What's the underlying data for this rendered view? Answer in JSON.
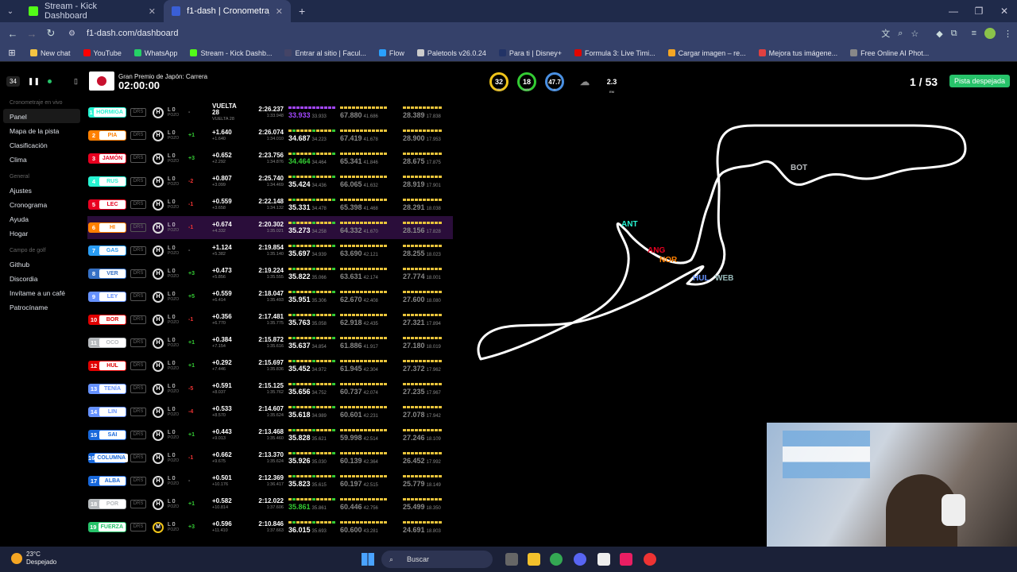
{
  "browser": {
    "tabs": [
      {
        "label": "Stream - Kick Dashboard",
        "color": "#53fc18"
      },
      {
        "label": "f1-dash | Cronometraje en vivo",
        "color": "#3a5fd6"
      }
    ],
    "url": "f1-dash.com/dashboard",
    "bookmarks": [
      {
        "label": "New chat",
        "color": "#f5c542"
      },
      {
        "label": "YouTube",
        "color": "#ff0000"
      },
      {
        "label": "WhatsApp",
        "color": "#25d366"
      },
      {
        "label": "Stream - Kick Dashb...",
        "color": "#53fc18"
      },
      {
        "label": "Entrar al sitio | Facul...",
        "color": "#444466"
      },
      {
        "label": "Flow",
        "color": "#2aa1ff"
      },
      {
        "label": "Paletools v26.0.24",
        "color": "#cccccc"
      },
      {
        "label": "Para ti | Disney+",
        "color": "#223366"
      },
      {
        "label": "Formula 3: Live Timi...",
        "color": "#e10600"
      },
      {
        "label": "Cargar imagen – re...",
        "color": "#f5a623"
      },
      {
        "label": "Mejora tus imágene...",
        "color": "#e04040"
      },
      {
        "label": "Free Online AI Phot...",
        "color": "#888888"
      }
    ]
  },
  "sidebar": {
    "badge": "34",
    "section_live": "Cronometraje en vivo",
    "items_live": [
      "Panel",
      "Mapa de la pista",
      "Clasificación",
      "Clima"
    ],
    "section_general": "General",
    "items_general": [
      "Ajustes",
      "Cronograma",
      "Ayuda",
      "Hogar"
    ],
    "section_golf": "Campo de golf",
    "items_golf": [
      "Github",
      "Discordia",
      "Invítame a un café",
      "Patrocíname"
    ]
  },
  "header": {
    "race_name": "Gran Premio de Japón: Carrera",
    "clock": "02:00:00",
    "gauges": [
      {
        "value": "32",
        "label": "TRC",
        "color": "#f0c419"
      },
      {
        "value": "18",
        "label": "AIRE",
        "color": "#3c3"
      },
      {
        "value": "47.7",
        "label": "H",
        "color": "#4a90e2"
      },
      {
        "value": "",
        "label": "",
        "color": "#555"
      },
      {
        "value": "2.3",
        "label": "EM",
        "color": "#555"
      }
    ],
    "laps": "1 / 53",
    "track_status": "Pista despejada"
  },
  "drivers": [
    {
      "pos": "1",
      "code": "HORMIGA",
      "color": "#27f4d2",
      "lap": "L 0",
      "pit": "POZO",
      "chg": "-",
      "gap": "VUELTA 28",
      "gap2": "VUELTA 28",
      "time": "2:26.237",
      "time2": "1:33.948",
      "s1": "33.933",
      "s1b": "33.933",
      "s2": "67.880",
      "s2b": "41.686",
      "s3": "28.389",
      "s3b": "17.838",
      "s1c": "pur"
    },
    {
      "pos": "2",
      "code": "PIA",
      "color": "#ff8000",
      "lap": "L 0",
      "pit": "POZO",
      "chg": "+1",
      "gap": "+1.640",
      "gap2": "+1.640",
      "time": "2:26.074",
      "time2": "1:34.010",
      "s1": "34.687",
      "s1b": "34.223",
      "s2": "67.419",
      "s2b": "41.678",
      "s3": "28.900",
      "s3b": "17.953",
      "s1c": ""
    },
    {
      "pos": "3",
      "code": "JAMÓN",
      "color": "#e80020",
      "lap": "L 0",
      "pit": "POZO",
      "chg": "+3",
      "gap": "+0.652",
      "gap2": "+2.292",
      "time": "2:23.756",
      "time2": "1:34.876",
      "s1": "34.464",
      "s1b": "34.464",
      "s2": "65.341",
      "s2b": "41.846",
      "s3": "28.675",
      "s3b": "17.875",
      "s1c": "grn"
    },
    {
      "pos": "4",
      "code": "RUS",
      "color": "#27f4d2",
      "lap": "L 0",
      "pit": "POZO",
      "chg": "-2",
      "gap": "+0.807",
      "gap2": "+3.099",
      "time": "2:25.740",
      "time2": "1:34.469",
      "s1": "35.424",
      "s1b": "34.436",
      "s2": "66.065",
      "s2b": "41.632",
      "s3": "28.919",
      "s3b": "17.901",
      "s1c": ""
    },
    {
      "pos": "5",
      "code": "LEC",
      "color": "#e80020",
      "lap": "L 0",
      "pit": "POZO",
      "chg": "-1",
      "gap": "+0.559",
      "gap2": "+3.658",
      "time": "2:22.148",
      "time2": "1:34.132",
      "s1": "35.331",
      "s1b": "34.478",
      "s2": "65.398",
      "s2b": "41.468",
      "s3": "28.291",
      "s3b": "18.038",
      "s1c": ""
    },
    {
      "pos": "6",
      "code": "HI",
      "color": "#ff8000",
      "lap": "L 0",
      "pit": "POZO",
      "chg": "-1",
      "gap": "+0.674",
      "gap2": "+4.332",
      "time": "2:20.302",
      "time2": "1:35.021",
      "s1": "35.273",
      "s1b": "34.258",
      "s2": "64.332",
      "s2b": "41.670",
      "s3": "28.156",
      "s3b": "17.828",
      "s1c": ""
    },
    {
      "pos": "7",
      "code": "GAS",
      "color": "#2a9df4",
      "lap": "L 0",
      "pit": "POZO",
      "chg": "-",
      "gap": "+1.124",
      "gap2": "+5.382",
      "time": "2:19.854",
      "time2": "1:35.140",
      "s1": "35.697",
      "s1b": "34.939",
      "s2": "63.690",
      "s2b": "42.121",
      "s3": "28.255",
      "s3b": "18.023",
      "s1c": ""
    },
    {
      "pos": "8",
      "code": "VER",
      "color": "#3671c6",
      "lap": "L 0",
      "pit": "POZO",
      "chg": "+3",
      "gap": "+0.473",
      "gap2": "+5.856",
      "time": "2:19.224",
      "time2": "1:35.555",
      "s1": "35.822",
      "s1b": "35.066",
      "s2": "63.631",
      "s2b": "42.174",
      "s3": "27.774",
      "s3b": "18.001",
      "s1c": ""
    },
    {
      "pos": "9",
      "code": "LEY",
      "color": "#6692ff",
      "lap": "L 0",
      "pit": "POZO",
      "chg": "+5",
      "gap": "+0.559",
      "gap2": "+6.414",
      "time": "2:18.047",
      "time2": "1:35.493",
      "s1": "35.951",
      "s1b": "35.306",
      "s2": "62.670",
      "s2b": "42.408",
      "s3": "27.600",
      "s3b": "18.080",
      "s1c": ""
    },
    {
      "pos": "10",
      "code": "BOR",
      "color": "#e00000",
      "lap": "L 0",
      "pit": "POZO",
      "chg": "-1",
      "gap": "+0.356",
      "gap2": "+6.770",
      "time": "2:17.481",
      "time2": "1:35.775",
      "s1": "35.763",
      "s1b": "35.058",
      "s2": "62.918",
      "s2b": "42.435",
      "s3": "27.321",
      "s3b": "17.894",
      "s1c": ""
    },
    {
      "pos": "11",
      "code": "OCO",
      "color": "#b6babd",
      "lap": "L 0",
      "pit": "POZO",
      "chg": "+1",
      "gap": "+0.384",
      "gap2": "+7.154",
      "time": "2:15.872",
      "time2": "1:35.616",
      "s1": "35.637",
      "s1b": "34.854",
      "s2": "61.886",
      "s2b": "41.917",
      "s3": "27.180",
      "s3b": "18.019",
      "s1c": ""
    },
    {
      "pos": "12",
      "code": "HUL",
      "color": "#e00000",
      "lap": "L 0",
      "pit": "POZO",
      "chg": "+1",
      "gap": "+0.292",
      "gap2": "+7.446",
      "time": "2:15.697",
      "time2": "1:35.836",
      "s1": "35.452",
      "s1b": "34.972",
      "s2": "61.945",
      "s2b": "42.304",
      "s3": "27.372",
      "s3b": "17.962",
      "s1c": ""
    },
    {
      "pos": "13",
      "code": "TENÍA",
      "color": "#6692ff",
      "lap": "L 0",
      "pit": "POZO",
      "chg": "-5",
      "gap": "+0.591",
      "gap2": "+8.037",
      "time": "2:15.125",
      "time2": "1:35.762",
      "s1": "35.656",
      "s1b": "34.752",
      "s2": "60.737",
      "s2b": "42.074",
      "s3": "27.235",
      "s3b": "17.967",
      "s1c": ""
    },
    {
      "pos": "14",
      "code": "LIN",
      "color": "#6692ff",
      "lap": "L 0",
      "pit": "POZO",
      "chg": "-4",
      "gap": "+0.533",
      "gap2": "+8.570",
      "time": "2:14.607",
      "time2": "1:35.624",
      "s1": "35.618",
      "s1b": "34.989",
      "s2": "60.601",
      "s2b": "42.231",
      "s3": "27.078",
      "s3b": "17.942",
      "s1c": ""
    },
    {
      "pos": "15",
      "code": "SAI",
      "color": "#1868db",
      "lap": "L 0",
      "pit": "POZO",
      "chg": "+1",
      "gap": "+0.443",
      "gap2": "+9.013",
      "time": "2:13.468",
      "time2": "1:35.460",
      "s1": "35.828",
      "s1b": "35.621",
      "s2": "59.998",
      "s2b": "42.514",
      "s3": "27.246",
      "s3b": "18.109",
      "s1c": ""
    },
    {
      "pos": "16",
      "code": "COLUMNA",
      "color": "#1868db",
      "lap": "L 0",
      "pit": "POZO",
      "chg": "-1",
      "gap": "+0.662",
      "gap2": "+9.675",
      "time": "2:13.370",
      "time2": "1:35.624",
      "s1": "35.926",
      "s1b": "35.030",
      "s2": "60.139",
      "s2b": "42.364",
      "s3": "26.452",
      "s3b": "17.992",
      "s1c": ""
    },
    {
      "pos": "17",
      "code": "ALBA",
      "color": "#1868db",
      "lap": "L 0",
      "pit": "POZO",
      "chg": "-",
      "gap": "+0.501",
      "gap2": "+10.176",
      "time": "2:12.369",
      "time2": "1:36.417",
      "s1": "35.823",
      "s1b": "35.615",
      "s2": "60.197",
      "s2b": "42.515",
      "s3": "25.779",
      "s3b": "18.149",
      "s1c": ""
    },
    {
      "pos": "18",
      "code": "POR",
      "color": "#b6babd",
      "lap": "L 0",
      "pit": "POZO",
      "chg": "+1",
      "gap": "+0.582",
      "gap2": "+10.814",
      "time": "2:12.022",
      "time2": "1:37.606",
      "s1": "35.861",
      "s1b": "35.861",
      "s2": "60.446",
      "s2b": "42.756",
      "s3": "25.499",
      "s3b": "18.350",
      "s1c": "grn"
    },
    {
      "pos": "19",
      "code": "FUERZA",
      "color": "#27c36a",
      "lap": "L 0",
      "pit": "POZO",
      "chg": "+3",
      "gap": "+0.596",
      "gap2": "+11.410",
      "time": "2:10.846",
      "time2": "1:37.663",
      "s1": "36.015",
      "s1b": "35.693",
      "s2": "60.600",
      "s2b": "43.281",
      "s3": "24.691",
      "s3b": "18.803",
      "s1c": ""
    }
  ],
  "map_labels": [
    {
      "text": "BOT",
      "color": "#b6babd"
    },
    {
      "text": "ANT",
      "color": "#27f4d2"
    },
    {
      "text": "ANG",
      "color": "#e80020"
    },
    {
      "text": "NOR",
      "color": "#ff8000"
    },
    {
      "text": "HUL",
      "color": "#6692ff"
    },
    {
      "text": "WEB",
      "color": "#9bb"
    }
  ],
  "taskbar": {
    "temp": "23°C",
    "weather": "Despejado",
    "search": "Buscar"
  }
}
